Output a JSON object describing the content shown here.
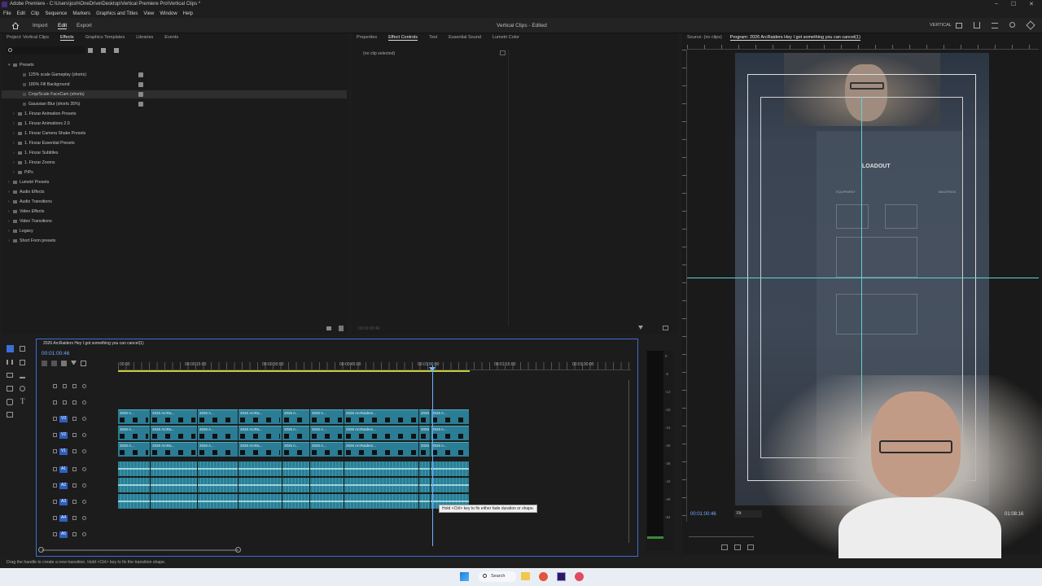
{
  "window": {
    "title": "Adobe Premiere - C:\\Users\\josh\\OneDrive\\Desktop\\Vertical Premiere Pro\\Vertical Clips *",
    "min": "–",
    "max": "☐",
    "close": "✕"
  },
  "menu": [
    "File",
    "Edit",
    "Clip",
    "Sequence",
    "Markers",
    "Graphics and Titles",
    "View",
    "Window",
    "Help"
  ],
  "toolbar": {
    "import": "Import",
    "edit": "Edit",
    "export": "Export",
    "project_title": "Vertical Clips - Edited",
    "workspace": "VERTICAL"
  },
  "effects_panel": {
    "tabs": [
      "Project: Vertical Clips",
      "Effects",
      "Graphics Templates",
      "Libraries",
      "Events"
    ],
    "active_tab": "Effects",
    "tree": [
      {
        "label": "Presets",
        "level": 0,
        "open": true
      },
      {
        "label": "125% scale Gameplay (shorts)",
        "level": 2
      },
      {
        "label": "180% Fill Background",
        "level": 2
      },
      {
        "label": "Crop/Scale FaceCam (shorts)",
        "level": 2
      },
      {
        "label": "Gaussian Blur (shorts 35%)",
        "level": 2
      },
      {
        "label": "1. Finzar Animation Presets",
        "level": 1
      },
      {
        "label": "1. Finzar Animations 2.0",
        "level": 1
      },
      {
        "label": "1. Finzar Camera Shake Presets",
        "level": 1
      },
      {
        "label": "1. Finzar Essential Presets",
        "level": 1
      },
      {
        "label": "1. Finzar Subtitles",
        "level": 1
      },
      {
        "label": "1. Finzar Zooms",
        "level": 1
      },
      {
        "label": "PiPs",
        "level": 1
      },
      {
        "label": "Lumetri Presets",
        "level": 0
      },
      {
        "label": "Audio Effects",
        "level": 0
      },
      {
        "label": "Audio Transitions",
        "level": 0
      },
      {
        "label": "Video Effects",
        "level": 0
      },
      {
        "label": "Video Transitions",
        "level": 0
      },
      {
        "label": "Legacy",
        "level": 0
      },
      {
        "label": "Short Form presets",
        "level": 0
      }
    ]
  },
  "effect_controls": {
    "tabs": [
      "Properties",
      "Effect Controls",
      "Text",
      "Essential Sound",
      "Lumetri Color"
    ],
    "active_tab": "Effect Controls",
    "empty": "(no clip selected)",
    "timecode": "00:01:00:46"
  },
  "program_monitor": {
    "tabs": [
      "Source: (no clips)",
      "Program: 2026 ArcRaiders Hey I got something you can cancel(1)"
    ],
    "timecode": "00:01:00:46",
    "fit": "Fit",
    "duration": "01:08:16",
    "hud_title": "LOADOUT",
    "hud_sub": "EQUIPMENT",
    "hud_backpack": "BACKPACK"
  },
  "timeline": {
    "sequence": "2026 ArcRaiders Hey I got something you can cancel(1)",
    "timecode": "00:01:00:46",
    "ruler": [
      "00:00",
      "00:00:15:00",
      "00:00:30:00",
      "00:00:45:00",
      "00:01:00:00",
      "00:01:15:00",
      "00:01:30:00"
    ],
    "video_tracks": [
      "V3",
      "V2",
      "V1"
    ],
    "audio_tracks": [
      "A1",
      "A2",
      "A3",
      "A4",
      "A5"
    ],
    "clip_label_a": "2026 A...",
    "clip_label_b": "2026 ArcRa...",
    "clip_label_c": "2026 ArcRaiders...",
    "tooltip": "Hold <Ctrl> key to fix either fade duration or shape.",
    "meter": [
      "0",
      "-6",
      "-12",
      "-18",
      "-24",
      "-30",
      "-36",
      "-42",
      "-48",
      "-54"
    ]
  },
  "status": "Drag the handle to create a new transition. Hold <Ctrl> key to fix the transition shape.",
  "taskbar": {
    "search": "Search"
  },
  "colors": {
    "accent": "#3b6fd6",
    "clip": "#2a7d94",
    "playhead": "#6fb0ff"
  }
}
